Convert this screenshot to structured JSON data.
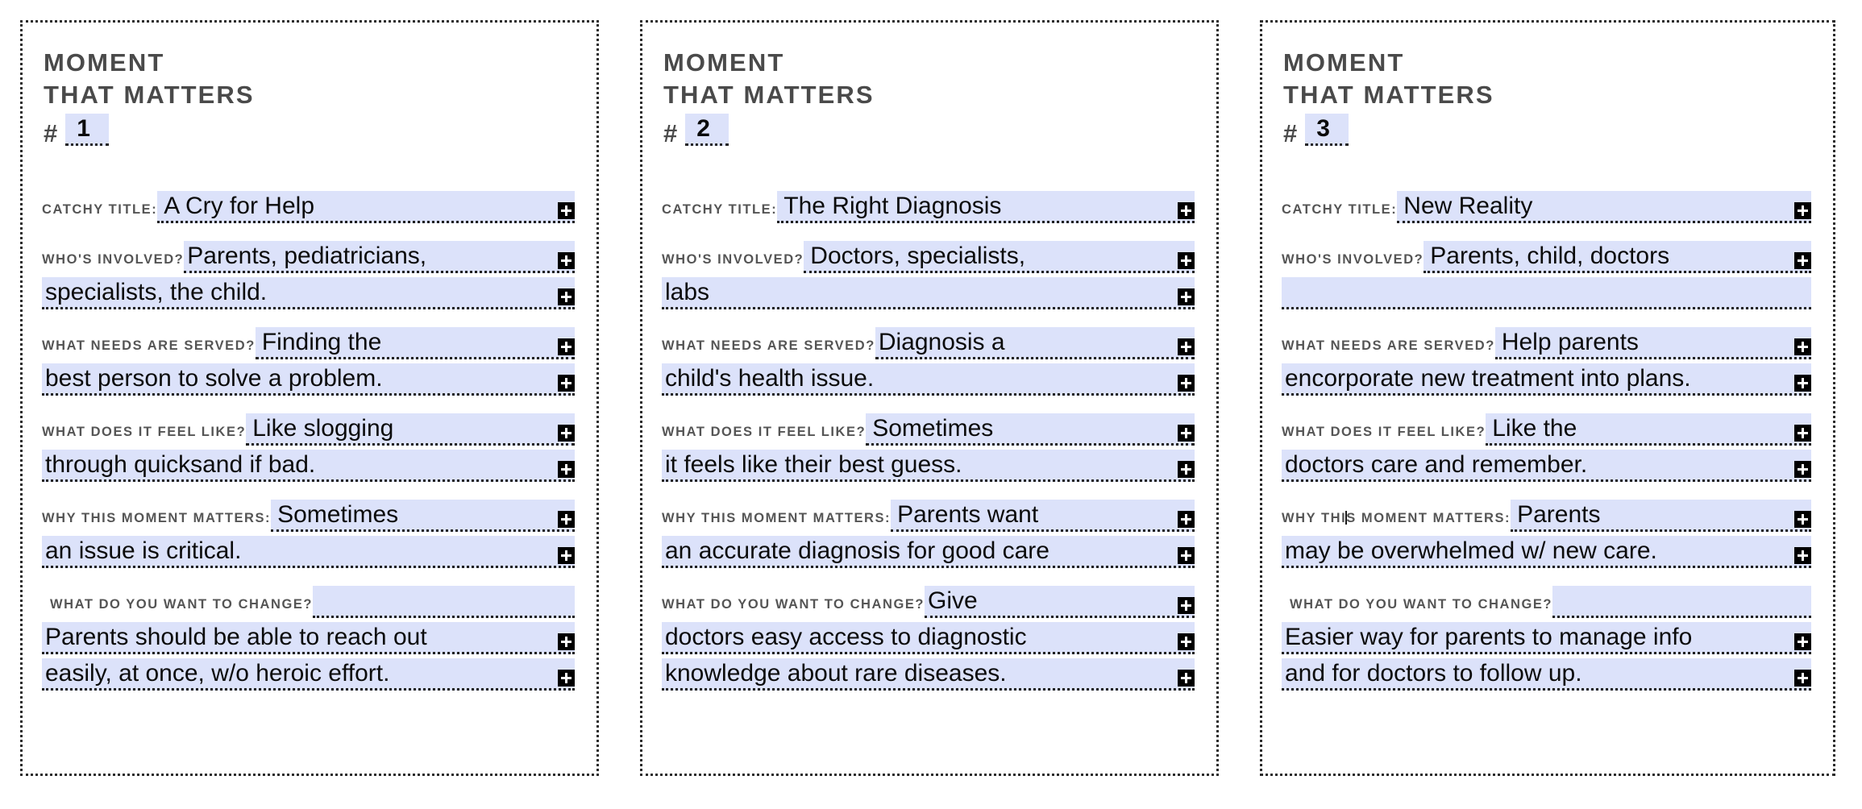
{
  "header": {
    "line1": "MOMENT",
    "line2": "THAT MATTERS",
    "hash": "#"
  },
  "labels": {
    "catchy_title": "Catchy Title:",
    "whos_involved": "Who's Involved?",
    "what_needs_are_served": "What needs are served?",
    "what_does_it_feel_like": "What does it feel like?",
    "why_this_moment_matters": "Why this moment matters:",
    "what_do_you_want_to_change": "What do you want to change?"
  },
  "colors": {
    "field_highlight": "#dce2fa",
    "label_text": "#555555",
    "header_text": "#4a4a4a",
    "value_text": "#0b0b0b",
    "plus_button_bg": "#000000",
    "card_border": "#2b2b2b"
  },
  "icons": {
    "plus": "plus-icon"
  },
  "cards": [
    {
      "number": "1",
      "catchy_title": {
        "line1": "A Cry for Help"
      },
      "whos_involved": {
        "line1": "Parents, pediatricians,",
        "line2": "specialists, the child."
      },
      "what_needs_are_served": {
        "line1": "Finding the",
        "line2": "best person to solve a problem."
      },
      "what_does_it_feel_like": {
        "line1": "Like slogging",
        "line2": "through quicksand if bad."
      },
      "why_this_moment_matters": {
        "line1": "Sometimes",
        "line2": "an issue is critical."
      },
      "what_do_you_want_to_change": {
        "line1": "",
        "line2": " Parents should be able to reach out",
        "line3": "easily, at once, w/o heroic effort."
      }
    },
    {
      "number": "2",
      "catchy_title": {
        "line1": "The Right Diagnosis"
      },
      "whos_involved": {
        "line1": "Doctors, specialists,",
        "line2": "labs"
      },
      "what_needs_are_served": {
        "line1": "Diagnosis a",
        "line2": "child's health issue."
      },
      "what_does_it_feel_like": {
        "line1": "Sometimes",
        "line2": " it feels like their best guess."
      },
      "why_this_moment_matters": {
        "line1": "Parents want",
        "line2": "an accurate diagnosis for good care"
      },
      "what_do_you_want_to_change": {
        "line1": "Give",
        "line2": "doctors easy access to diagnostic",
        "line3": "knowledge about rare diseases."
      }
    },
    {
      "number": "3",
      "catchy_title": {
        "line1": "New Reality"
      },
      "whos_involved": {
        "line1": "Parents, child, doctors",
        "line2": ""
      },
      "what_needs_are_served": {
        "line1": "Help parents",
        "line2": "encorporate new treatment into plans."
      },
      "what_does_it_feel_like": {
        "line1": "Like the",
        "line2": "doctors care and remember."
      },
      "why_this_moment_matters": {
        "line1": "Parents",
        "line2": "may be overwhelmed w/ new care."
      },
      "what_do_you_want_to_change": {
        "line1": "",
        "line2": "Easier way for parents to manage info",
        "line3": "and for doctors to follow up."
      }
    }
  ]
}
